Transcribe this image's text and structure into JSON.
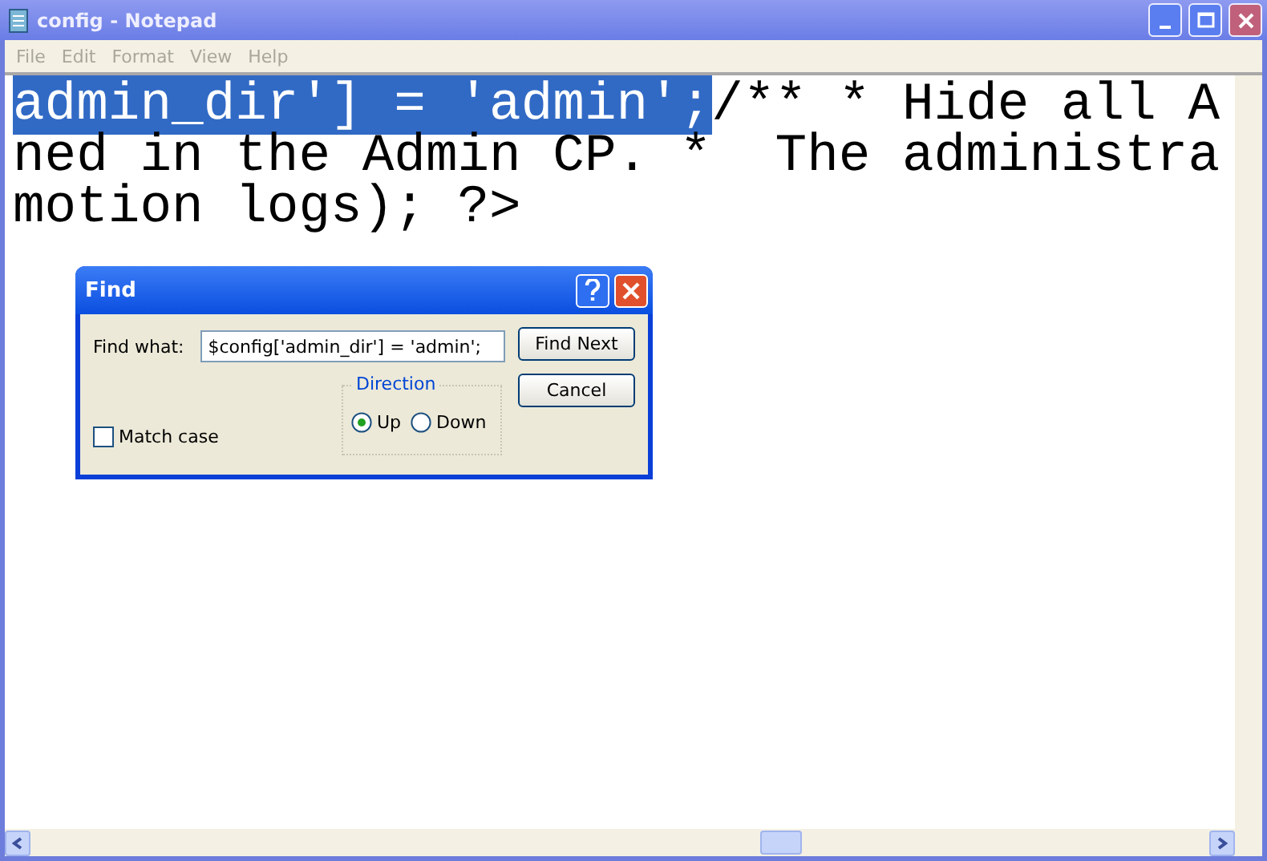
{
  "window": {
    "title": "config - Notepad"
  },
  "menu": [
    "File",
    "Edit",
    "Format",
    "View",
    "Help"
  ],
  "text_lines": [
    {
      "segments": [
        {
          "text": "admin_dir'] = 'admin';",
          "selected": true
        },
        {
          "text": "/** * Hide all A",
          "selected": false
        }
      ]
    },
    {
      "segments": [
        {
          "text": "ned in the Admin CP. *  The administra",
          "selected": false
        }
      ]
    },
    {
      "segments": [
        {
          "text": "motion logs); ?>",
          "selected": false
        }
      ]
    }
  ],
  "find_dialog": {
    "title": "Find",
    "find_what_label": "Find what:",
    "find_what_value": "$config['admin_dir'] = 'admin';",
    "buttons": [
      "Find Next",
      "Cancel"
    ],
    "direction_label": "Direction",
    "direction_options": [
      {
        "label": "Up",
        "selected": true
      },
      {
        "label": "Down",
        "selected": false
      }
    ],
    "match_case": {
      "label": "Match case",
      "checked": false
    }
  }
}
